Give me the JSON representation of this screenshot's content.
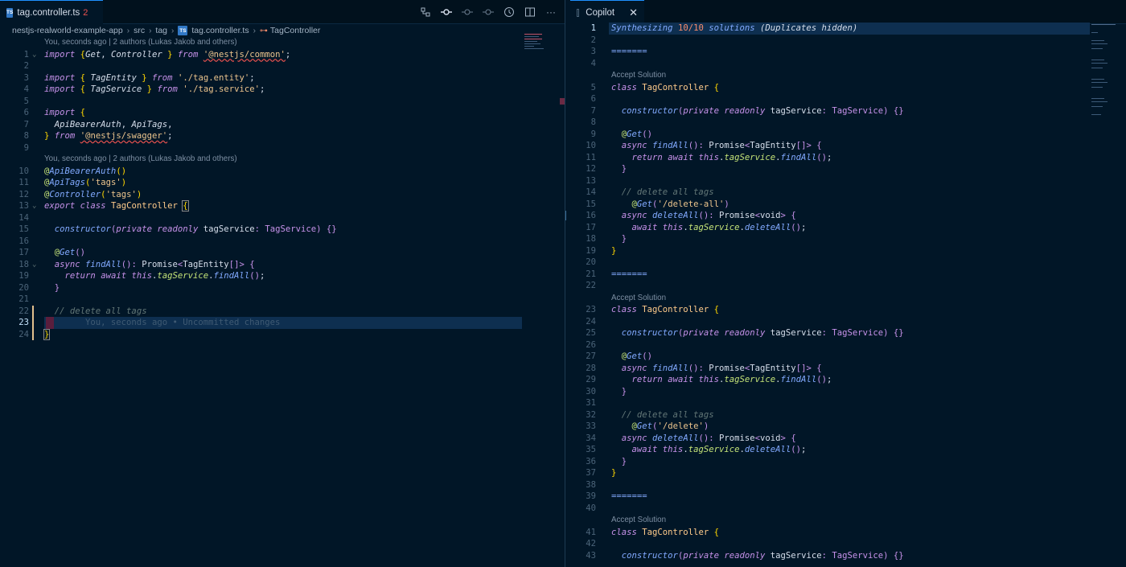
{
  "left_pane": {
    "tab": {
      "icon_text": "TS",
      "title": "tag.controller.ts",
      "problem_count": "2"
    },
    "breadcrumb": {
      "items": [
        "nestjs-realworld-example-app",
        "src",
        "tag",
        "tag.controller.ts",
        "TagController"
      ],
      "file_icon_text": "TS"
    },
    "codelens": [
      "You, seconds ago | 2 authors (Lukas Jakob and others)",
      "You, seconds ago | 2 authors (Lukas Jakob and others)"
    ],
    "inline_blame": "You, seconds ago • Uncommitted changes",
    "line_numbers": [
      "1",
      "2",
      "3",
      "4",
      "5",
      "6",
      "7",
      "8",
      "9",
      "10",
      "11",
      "12",
      "13",
      "14",
      "15",
      "16",
      "17",
      "18",
      "19",
      "20",
      "21",
      "22",
      "23",
      "24"
    ]
  },
  "right_pane": {
    "tab": {
      "title": "Copilot"
    },
    "header_line": {
      "prefix": "Synthesizing",
      "count": "10/10",
      "suffix": "solutions",
      "note": "(Duplicates hidden)"
    },
    "separator": "=======",
    "accept_label": "Accept Solution",
    "line_numbers": [
      "1",
      "2",
      "3",
      "4",
      "5",
      "6",
      "7",
      "8",
      "9",
      "10",
      "11",
      "12",
      "13",
      "14",
      "15",
      "16",
      "17",
      "18",
      "19",
      "20",
      "21",
      "22",
      "23",
      "24",
      "25",
      "26",
      "27",
      "28",
      "29",
      "30",
      "31",
      "32",
      "33",
      "34",
      "35",
      "36",
      "37",
      "38",
      "39",
      "40",
      "41",
      "42",
      "43"
    ],
    "solution_routes": [
      "'/delete-all'",
      "'/delete'"
    ]
  },
  "colors": {
    "background": "#011627",
    "keyword": "#c792ea",
    "function": "#82aaff",
    "string": "#ecc48d",
    "decorator": "#c5e478",
    "comment": "#637777"
  },
  "icons": [
    "typescript-file-icon",
    "source-control-icon",
    "git-commit-icon",
    "previous-change-icon",
    "next-change-icon",
    "timeline-icon",
    "split-editor-icon",
    "more-actions-icon",
    "close-icon",
    "symbol-class-icon"
  ]
}
